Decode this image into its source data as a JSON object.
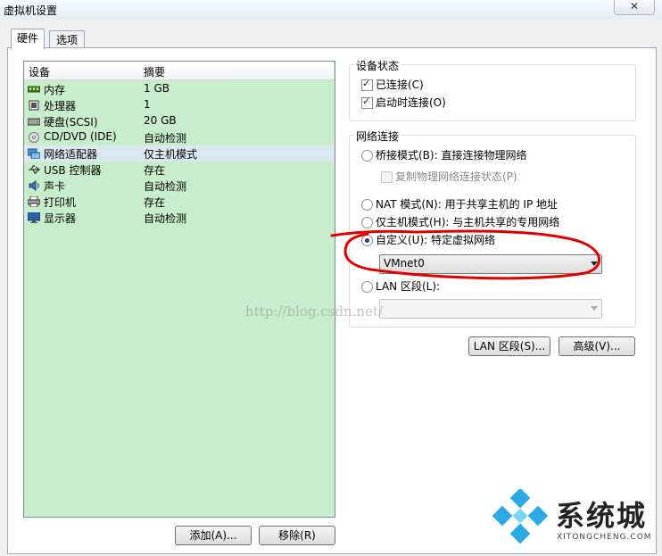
{
  "window": {
    "title": "虚拟机设置",
    "close_glyph": "✕"
  },
  "tabs": [
    {
      "label": "硬件"
    },
    {
      "label": "选项"
    }
  ],
  "device_list": {
    "col_device": "设备",
    "col_summary": "摘要",
    "rows": [
      {
        "name": "内存",
        "summary": "1 GB",
        "icon": "memory-icon"
      },
      {
        "name": "处理器",
        "summary": "1",
        "icon": "processor-icon"
      },
      {
        "name": "硬盘(SCSI)",
        "summary": "20 GB",
        "icon": "hard-disk-icon"
      },
      {
        "name": "CD/DVD (IDE)",
        "summary": "自动检测",
        "icon": "cd-dvd-icon"
      },
      {
        "name": "网络适配器",
        "summary": "仅主机模式",
        "icon": "network-adapter-icon"
      },
      {
        "name": "USB 控制器",
        "summary": "存在",
        "icon": "usb-icon"
      },
      {
        "name": "声卡",
        "summary": "自动检测",
        "icon": "sound-card-icon"
      },
      {
        "name": "打印机",
        "summary": "存在",
        "icon": "printer-icon"
      },
      {
        "name": "显示器",
        "summary": "自动检测",
        "icon": "display-icon"
      }
    ],
    "add_button": "添加(A)...",
    "remove_button": "移除(R)"
  },
  "device_status": {
    "title": "设备状态",
    "connected": {
      "label": "已连接(C)",
      "checked": true
    },
    "connect_at_power_on": {
      "label": "启动时连接(O)",
      "checked": true
    }
  },
  "network_connection": {
    "title": "网络连接",
    "bridged": {
      "label": "桥接模式(B): 直接连接物理网络",
      "selected": false
    },
    "replicate_state": {
      "label": "复制物理网络连接状态(P)",
      "checked": false,
      "enabled": false
    },
    "nat": {
      "label": "NAT 模式(N): 用于共享主机的 IP 地址",
      "selected": false
    },
    "host_only": {
      "label": "仅主机模式(H): 与主机共享的专用网络",
      "selected": false
    },
    "custom": {
      "label": "自定义(U): 特定虚拟网络",
      "selected": true
    },
    "custom_network_value": "VMnet0",
    "lan_segment": {
      "label": "LAN 区段(L):",
      "selected": false
    },
    "lan_segment_value": ""
  },
  "buttons": {
    "lan_segments": "LAN 区段(S)...",
    "advanced": "高级(V)..."
  },
  "watermark": "http://blog.csdn.net/",
  "logo": {
    "text": "系统城",
    "sub": "XITONGCHENG.COM"
  },
  "colors": {
    "device_list_bg": "#c8edcb",
    "annotation_red": "#e00000",
    "logo_blue": "#1ea0e0"
  }
}
